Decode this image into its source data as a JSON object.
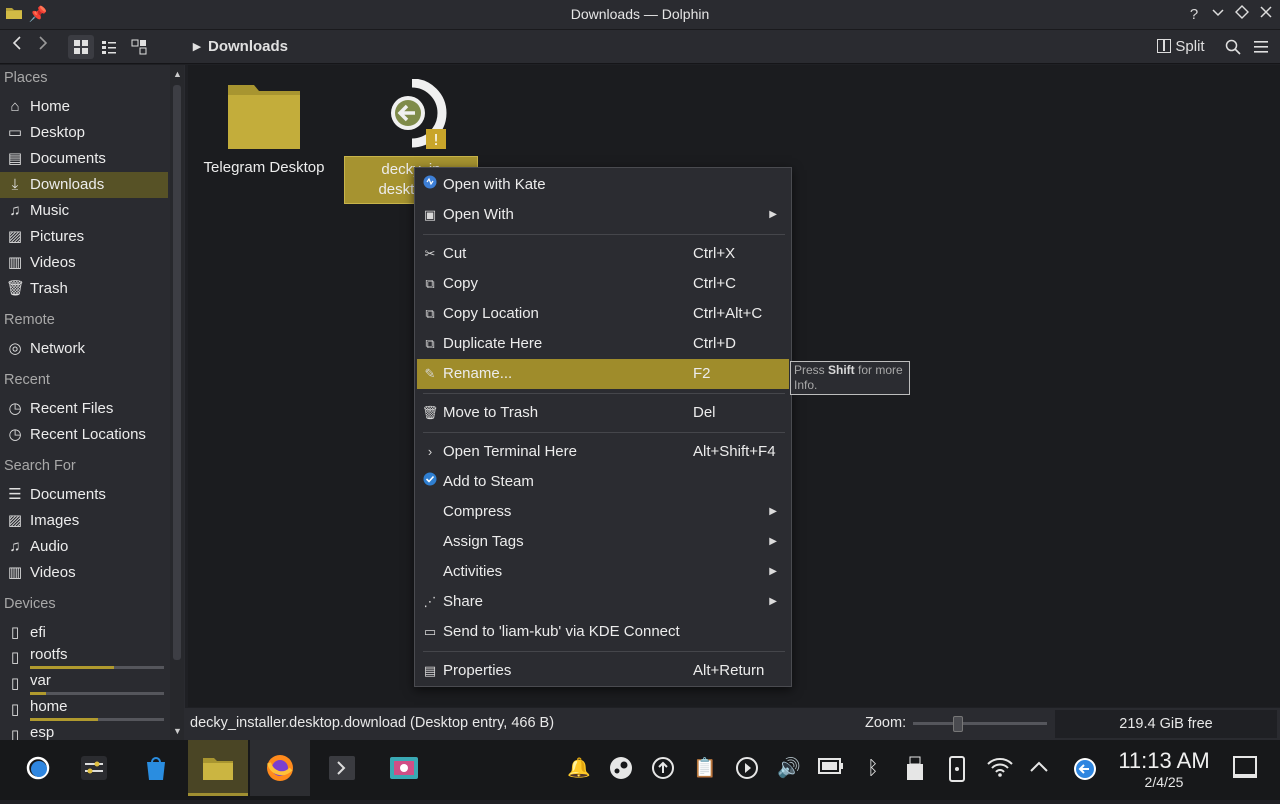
{
  "window": {
    "title": "Downloads — Dolphin"
  },
  "toolbar": {
    "breadcrumb": "Downloads",
    "split_label": "Split"
  },
  "sidebar": {
    "sections": [
      "Places",
      "Remote",
      "Recent",
      "Search For",
      "Devices"
    ],
    "places": [
      "Home",
      "Desktop",
      "Documents",
      "Downloads",
      "Music",
      "Pictures",
      "Videos",
      "Trash"
    ],
    "remote": [
      "Network"
    ],
    "recent": [
      "Recent Files",
      "Recent Locations"
    ],
    "search": [
      "Documents",
      "Images",
      "Audio",
      "Videos"
    ],
    "devices": [
      {
        "label": "efi"
      },
      {
        "label": "rootfs",
        "usage": 0.63
      },
      {
        "label": "var",
        "usage": 0.12
      },
      {
        "label": "home",
        "usage": 0.51
      },
      {
        "label": "esp"
      }
    ]
  },
  "files": [
    {
      "name": "Telegram Desktop"
    },
    {
      "name_line1": "decky_in",
      "name_line2": "desktop.d"
    }
  ],
  "menu": {
    "items": [
      {
        "label": "Open with Kate",
        "shortcut": "",
        "submenu": false
      },
      {
        "label": "Open With",
        "shortcut": "",
        "submenu": true
      },
      {
        "label": "Cut",
        "shortcut": "Ctrl+X",
        "submenu": false
      },
      {
        "label": "Copy",
        "shortcut": "Ctrl+C",
        "submenu": false
      },
      {
        "label": "Copy Location",
        "shortcut": "Ctrl+Alt+C",
        "submenu": false
      },
      {
        "label": "Duplicate Here",
        "shortcut": "Ctrl+D",
        "submenu": false
      },
      {
        "label": "Rename...",
        "shortcut": "F2",
        "submenu": false
      },
      {
        "label": "Move to Trash",
        "shortcut": "Del",
        "submenu": false
      },
      {
        "label": "Open Terminal Here",
        "shortcut": "Alt+Shift+F4",
        "submenu": false
      },
      {
        "label": "Add to Steam",
        "shortcut": "",
        "submenu": false
      },
      {
        "label": "Compress",
        "shortcut": "",
        "submenu": true
      },
      {
        "label": "Assign Tags",
        "shortcut": "",
        "submenu": true
      },
      {
        "label": "Activities",
        "shortcut": "",
        "submenu": true
      },
      {
        "label": "Share",
        "shortcut": "",
        "submenu": true
      },
      {
        "label": "Send to 'liam-kub' via KDE Connect",
        "shortcut": "",
        "submenu": false
      },
      {
        "label": "Properties",
        "shortcut": "Alt+Return",
        "submenu": false
      }
    ]
  },
  "tooltip": {
    "pre": "Press ",
    "bold": "Shift",
    "post": " for more Info."
  },
  "status": {
    "selection": "decky_installer.desktop.download (Desktop entry, 466 B)",
    "zoom_label": "Zoom:",
    "free_space": "219.4 GiB free"
  },
  "clock": {
    "time": "11:13 AM",
    "date": "2/4/25"
  },
  "colors": {
    "accent": "#9f8c2b",
    "selection": "#575226",
    "background": "#1b1c1f"
  }
}
